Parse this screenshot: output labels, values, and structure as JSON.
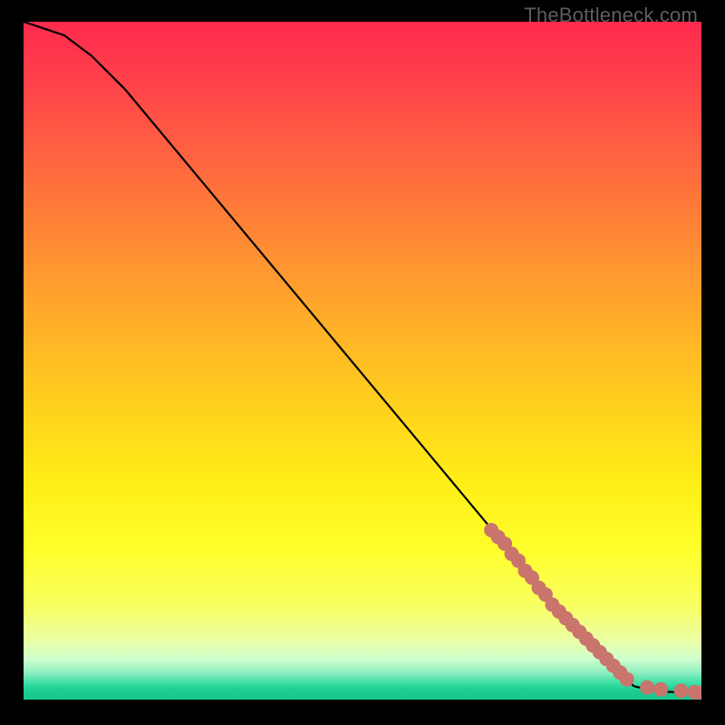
{
  "attribution": "TheBottleneck.com",
  "colors": {
    "curve": "#000000",
    "marker": "#c9746d",
    "gradient_top": "#ff2a4d",
    "gradient_bottom": "#17c68f"
  },
  "chart_data": {
    "type": "line",
    "title": "",
    "xlabel": "",
    "ylabel": "",
    "xlim": [
      0,
      100
    ],
    "ylim": [
      0,
      100
    ],
    "grid": false,
    "curve": {
      "x": [
        0,
        3,
        6,
        10,
        15,
        20,
        30,
        40,
        50,
        60,
        70,
        74,
        78,
        82,
        84,
        86,
        88,
        89,
        90,
        92,
        94,
        96,
        98,
        100
      ],
      "y": [
        100,
        99,
        98,
        95,
        90,
        84,
        72,
        60,
        48,
        36,
        24,
        19,
        14,
        10,
        8,
        6,
        4,
        3,
        2,
        1.5,
        1.2,
        1.1,
        1.05,
        1.0
      ]
    },
    "series": [
      {
        "name": "markers",
        "type": "scatter",
        "x": [
          69,
          70,
          71,
          72,
          73,
          74,
          75,
          76,
          77,
          78,
          79,
          80,
          81,
          82,
          83,
          84,
          85,
          86,
          87,
          88,
          89,
          92,
          94,
          97,
          99,
          100
        ],
        "y": [
          25,
          24,
          23,
          21.5,
          20.5,
          19,
          18,
          16.5,
          15.5,
          14,
          13,
          12,
          11,
          10,
          9,
          8,
          7,
          6,
          5,
          4,
          3,
          1.8,
          1.5,
          1.3,
          1.1,
          1.0
        ]
      }
    ]
  }
}
